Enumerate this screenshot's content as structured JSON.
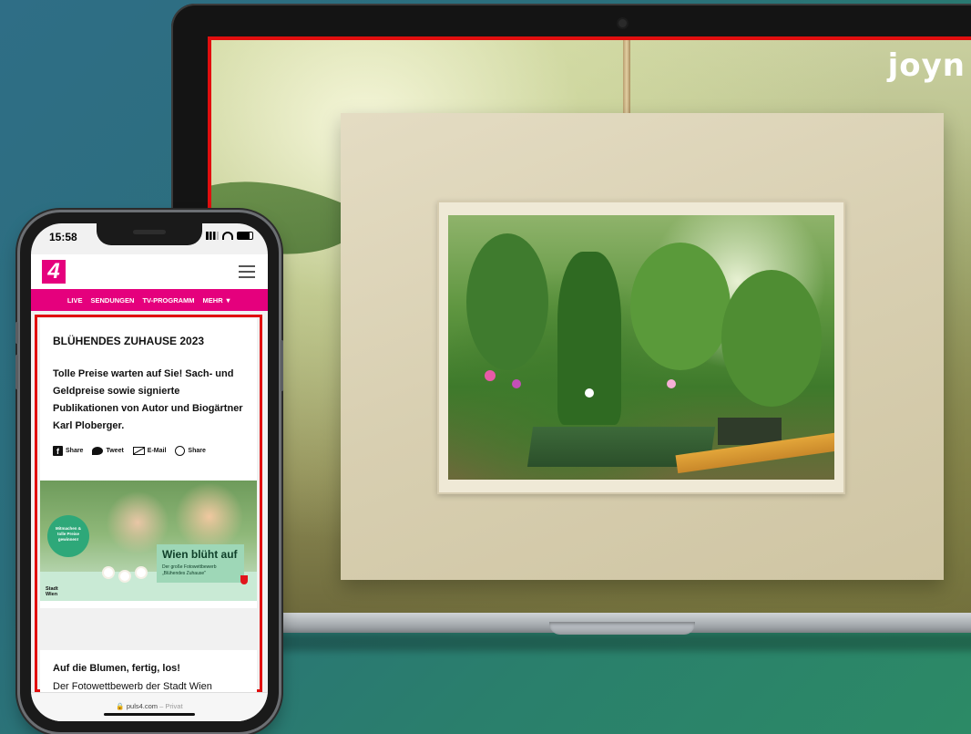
{
  "brand": {
    "logo_text": "joyn"
  },
  "phone": {
    "status_time": "15:58",
    "site_logo": "4",
    "nav": [
      "LIVE",
      "SENDUNGEN",
      "TV-PROGRAMM",
      "MEHR ▼"
    ],
    "article": {
      "title": "BLÜHENDES ZUHAUSE 2023",
      "lead": "Tolle Preise warten auf Sie! Sach- und Geldpreise sowie signierte Publikationen von Autor und Biogärtner Karl Ploberger.",
      "share": [
        {
          "icon": "facebook-icon",
          "label": "Share"
        },
        {
          "icon": "twitter-icon",
          "label": "Tweet"
        },
        {
          "icon": "mail-icon",
          "label": "E-Mail"
        },
        {
          "icon": "whatsapp-icon",
          "label": "Share"
        }
      ],
      "banner": {
        "badge": "Mitmachen & tolle Preise gewinnen!",
        "headline": "Wien blüht auf",
        "subtitle": "Der große Fotowettbewerb „Blühendes Zuhause\"",
        "city": "Stadt Wien"
      }
    },
    "second_card": {
      "title": "Auf die Blumen, fertig, los!",
      "text": "Der Fotowettbewerb der Stadt Wien"
    },
    "url": {
      "domain": "puls4.com",
      "mode": "– Privat"
    }
  },
  "colors": {
    "accent": "#e5007d",
    "highlight_border": "#e10e0e"
  }
}
